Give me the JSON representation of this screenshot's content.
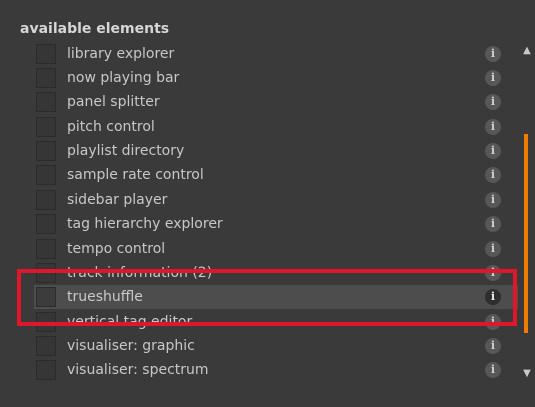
{
  "section": {
    "title": "available elements"
  },
  "items": [
    {
      "label": "library explorer",
      "info": "i"
    },
    {
      "label": "now playing bar",
      "info": "i"
    },
    {
      "label": "panel splitter",
      "info": "i"
    },
    {
      "label": "pitch control",
      "info": "i"
    },
    {
      "label": "playlist directory",
      "info": "i"
    },
    {
      "label": "sample rate control",
      "info": "i"
    },
    {
      "label": "sidebar player",
      "info": "i"
    },
    {
      "label": "tag hierarchy explorer",
      "info": "i"
    },
    {
      "label": "tempo control",
      "info": "i"
    },
    {
      "label": "track information (2)",
      "info": "i"
    },
    {
      "label": "trueshuffle",
      "info": "i"
    },
    {
      "label": "vertical tag editor",
      "info": "i"
    },
    {
      "label": "visualiser: graphic",
      "info": "i"
    },
    {
      "label": "visualiser: spectrum",
      "info": "i"
    }
  ],
  "scrollbar": {
    "up_glyph": "▲",
    "down_glyph": "▼",
    "thumb_color": "#f07c00"
  },
  "colors": {
    "background": "#3a3a3a",
    "hover_row": "#4d4d4d",
    "highlight": "#e0162b"
  }
}
